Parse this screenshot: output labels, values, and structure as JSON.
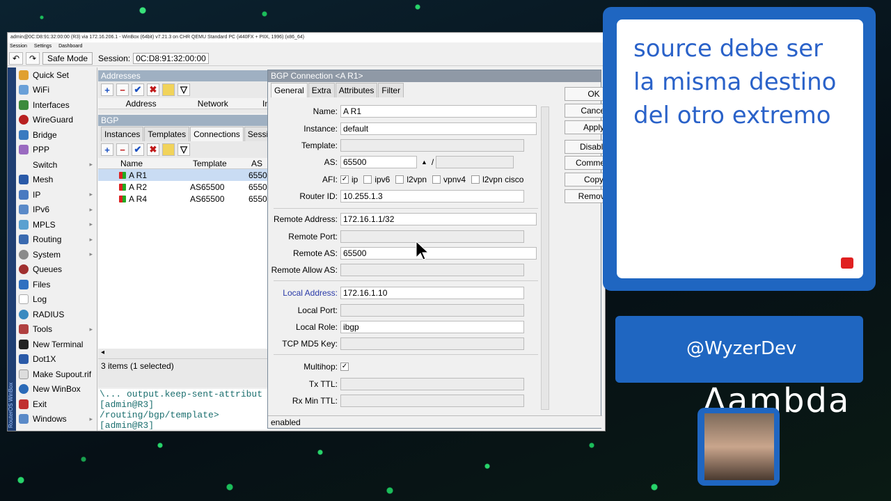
{
  "window": {
    "title": "admin@0C:D8:91:32:00:00 (R3) via 172.16.206.1 - WinBox (64bit) v7.21.3 on CHR QEMU Standard PC (i440FX + PIIX, 1996) (x86_64)",
    "side_label": "RouterOS WinBox"
  },
  "menu": [
    "Session",
    "Settings",
    "Dashboard"
  ],
  "toolbar": {
    "safe_mode": "Safe Mode",
    "session_label": "Session:",
    "session_value": "0C:D8:91:32:00:00"
  },
  "sidebar": [
    "Quick Set",
    "WiFi",
    "Interfaces",
    "WireGuard",
    "Bridge",
    "PPP",
    "Switch",
    "Mesh",
    "IP",
    "IPv6",
    "MPLS",
    "Routing",
    "System",
    "Queues",
    "Files",
    "Log",
    "RADIUS",
    "Tools",
    "New Terminal",
    "Dot1X",
    "Make Supout.rif",
    "New WinBox",
    "Exit",
    "Windows"
  ],
  "addresses": {
    "title": "Addresses",
    "columns": [
      "Address",
      "Network",
      "In"
    ]
  },
  "bgp": {
    "title": "BGP",
    "tabs": [
      "Instances",
      "Templates",
      "Connections",
      "Sessions"
    ],
    "columns": [
      "Name",
      "Template",
      "AS"
    ],
    "rows": [
      {
        "name": "A R1",
        "template": "",
        "as": "6550"
      },
      {
        "name": "A R2",
        "template": "AS65500",
        "as": "6550"
      },
      {
        "name": "A R4",
        "template": "AS65500",
        "as": "6550"
      }
    ],
    "status": "3 items (1 selected)"
  },
  "terminal": [
    "\\...      output.keep-sent-attribut",
    "[admin@R3] /routing/bgp/template>",
    "[admin@R3] /routing/bgp/template>"
  ],
  "dialog": {
    "title": "BGP Connection <A R1>",
    "tabs": [
      "General",
      "Extra",
      "Attributes",
      "Filter"
    ],
    "fields": {
      "name": {
        "label": "Name:",
        "value": "A R1"
      },
      "instance": {
        "label": "Instance:",
        "value": "default"
      },
      "template": {
        "label": "Template:"
      },
      "as": {
        "label": "AS:",
        "value": "65500",
        "sep": "/"
      },
      "afi": {
        "label": "AFI:",
        "options": [
          "ip",
          "ipv6",
          "l2vpn",
          "vpnv4",
          "l2vpn cisco"
        ]
      },
      "router_id": {
        "label": "Router ID:",
        "value": "10.255.1.3"
      },
      "remote_address": {
        "label": "Remote Address:",
        "value": "172.16.1.1/32"
      },
      "remote_port": {
        "label": "Remote Port:"
      },
      "remote_as": {
        "label": "Remote AS:",
        "value": "65500"
      },
      "remote_allow_as": {
        "label": "Remote Allow AS:"
      },
      "local_address": {
        "label": "Local Address:",
        "value": "172.16.1.10"
      },
      "local_port": {
        "label": "Local Port:"
      },
      "local_role": {
        "label": "Local Role:",
        "value": "ibgp"
      },
      "tcp_md5": {
        "label": "TCP MD5 Key:"
      },
      "multihop": {
        "label": "Multihop:"
      },
      "tx_ttl": {
        "label": "Tx TTL:"
      },
      "rx_min_ttl": {
        "label": "Rx Min TTL:"
      }
    },
    "buttons": [
      "OK",
      "Cancel",
      "Apply",
      "Disable",
      "Comment",
      "Copy",
      "Remove"
    ],
    "status": "enabled"
  },
  "overlay": {
    "note": "source debe ser la misma destino del otro extremo",
    "handle": "@WyzerDev"
  }
}
